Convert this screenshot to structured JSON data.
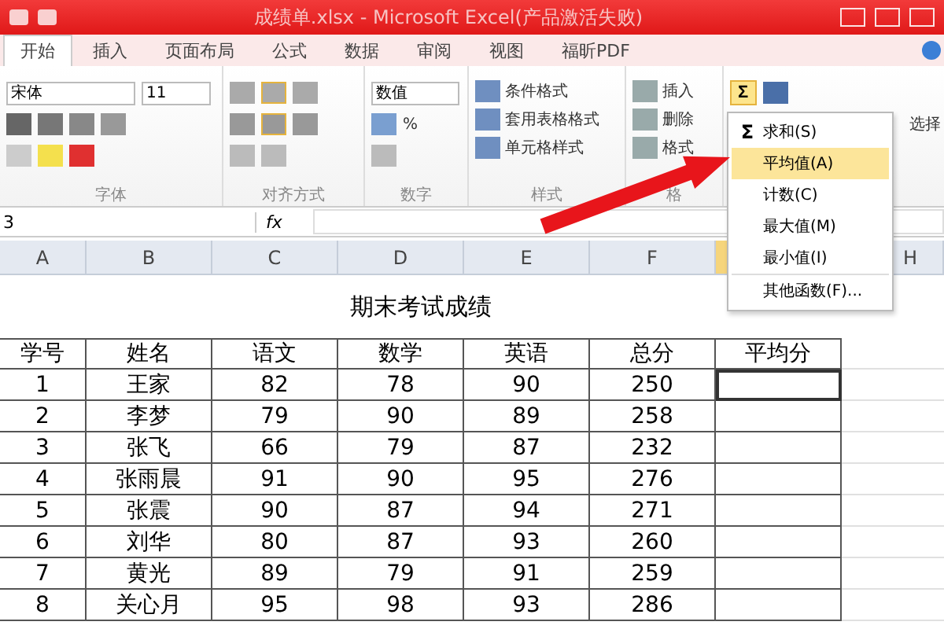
{
  "window": {
    "title": "成绩单.xlsx - Microsoft Excel(产品激活失败)"
  },
  "ribbon": {
    "tabs": [
      {
        "label": "开始",
        "selected": true
      },
      {
        "label": "插入",
        "selected": false
      },
      {
        "label": "页面布局",
        "selected": false
      },
      {
        "label": "公式",
        "selected": false
      },
      {
        "label": "数据",
        "selected": false
      },
      {
        "label": "审阅",
        "selected": false
      },
      {
        "label": "视图",
        "selected": false
      },
      {
        "label": "福昕PDF",
        "selected": false
      }
    ],
    "font": {
      "name": "宋体",
      "size": "11",
      "group": "字体"
    },
    "alignment": {
      "group": "对齐方式"
    },
    "number": {
      "format": "数值",
      "percent": "%",
      "group": "数字"
    },
    "styles": {
      "buttons": [
        "条件格式",
        "套用表格格式",
        "单元格样式"
      ],
      "group": "样式"
    },
    "cells": {
      "buttons": [
        "插入",
        "删除",
        "格式"
      ],
      "group": "格"
    },
    "editing": {
      "sum": "Σ",
      "select": "选择"
    }
  },
  "autosum_menu": {
    "items": [
      {
        "label": "求和(S)",
        "icon": "Σ",
        "selected": false
      },
      {
        "label": "平均值(A)",
        "selected": true
      },
      {
        "label": "计数(C)",
        "selected": false
      },
      {
        "label": "最大值(M)",
        "selected": false
      },
      {
        "label": "最小值(I)",
        "selected": false
      },
      {
        "label": "其他函数(F)...",
        "selected": false
      }
    ]
  },
  "formula_bar": {
    "name_box": "3",
    "fx": "fx"
  },
  "columns": [
    {
      "label": "A",
      "selected": false
    },
    {
      "label": "B",
      "selected": false
    },
    {
      "label": "C",
      "selected": false
    },
    {
      "label": "D",
      "selected": false
    },
    {
      "label": "E",
      "selected": false
    },
    {
      "label": "F",
      "selected": false
    },
    {
      "selected": true
    },
    {
      "label": "H",
      "selected": false
    }
  ],
  "sheet": {
    "title": "期末考试成绩",
    "headers": [
      "学号",
      "姓名",
      "语文",
      "数学",
      "英语",
      "总分",
      "平均分"
    ],
    "rows": [
      {
        "cells": [
          "1",
          "王家",
          "82",
          "78",
          "90",
          "250",
          ""
        ],
        "active": true
      },
      {
        "cells": [
          "2",
          "李梦",
          "79",
          "90",
          "89",
          "258",
          ""
        ],
        "active": false
      },
      {
        "cells": [
          "3",
          "张飞",
          "66",
          "79",
          "87",
          "232",
          ""
        ],
        "active": false
      },
      {
        "cells": [
          "4",
          "张雨晨",
          "91",
          "90",
          "95",
          "276",
          ""
        ],
        "active": false
      },
      {
        "cells": [
          "5",
          "张震",
          "90",
          "87",
          "94",
          "271",
          ""
        ],
        "active": false
      },
      {
        "cells": [
          "6",
          "刘华",
          "80",
          "87",
          "93",
          "260",
          ""
        ],
        "active": false
      },
      {
        "cells": [
          "7",
          "黄光",
          "89",
          "79",
          "91",
          "259",
          ""
        ],
        "active": false
      },
      {
        "cells": [
          "8",
          "关心月",
          "95",
          "98",
          "93",
          "286",
          ""
        ],
        "active": false
      }
    ]
  }
}
